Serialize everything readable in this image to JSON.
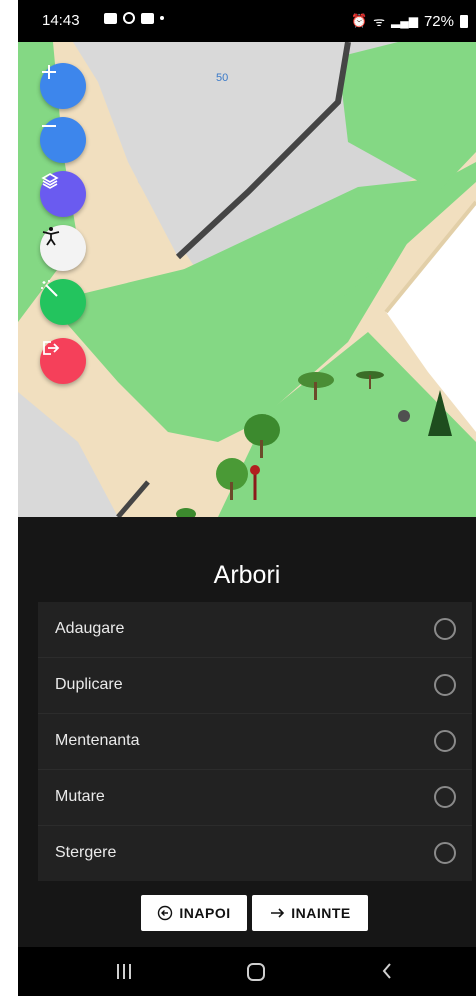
{
  "status_bar": {
    "time": "14:43",
    "battery": "72%"
  },
  "map": {
    "label": "50"
  },
  "fabs": [
    {
      "name": "zoom-in-button",
      "icon": "plus-icon",
      "color": "#3d86ec"
    },
    {
      "name": "zoom-out-button",
      "icon": "minus-icon",
      "color": "#3d86ec"
    },
    {
      "name": "layers-button",
      "icon": "layers-icon",
      "color": "#6a5bf0"
    },
    {
      "name": "accessibility-button",
      "icon": "accessibility-icon",
      "color": "#f3f3f3"
    },
    {
      "name": "magic-wand-button",
      "icon": "magic-wand-icon",
      "color": "#23c45e"
    },
    {
      "name": "logout-button",
      "icon": "logout-icon",
      "color": "#f5405a"
    }
  ],
  "sheet": {
    "title": "Arbori",
    "options": [
      {
        "label": "Adaugare",
        "selected": false
      },
      {
        "label": "Duplicare",
        "selected": false
      },
      {
        "label": "Mentenanta",
        "selected": false
      },
      {
        "label": "Mutare",
        "selected": false
      },
      {
        "label": "Stergere",
        "selected": false
      }
    ],
    "back_label": "INAPOI",
    "next_label": "INAINTE"
  },
  "colors": {
    "grass": "#84d884",
    "path": "#f1dfbf",
    "building": "#d9d9d9",
    "sheet_bg": "#161616"
  }
}
